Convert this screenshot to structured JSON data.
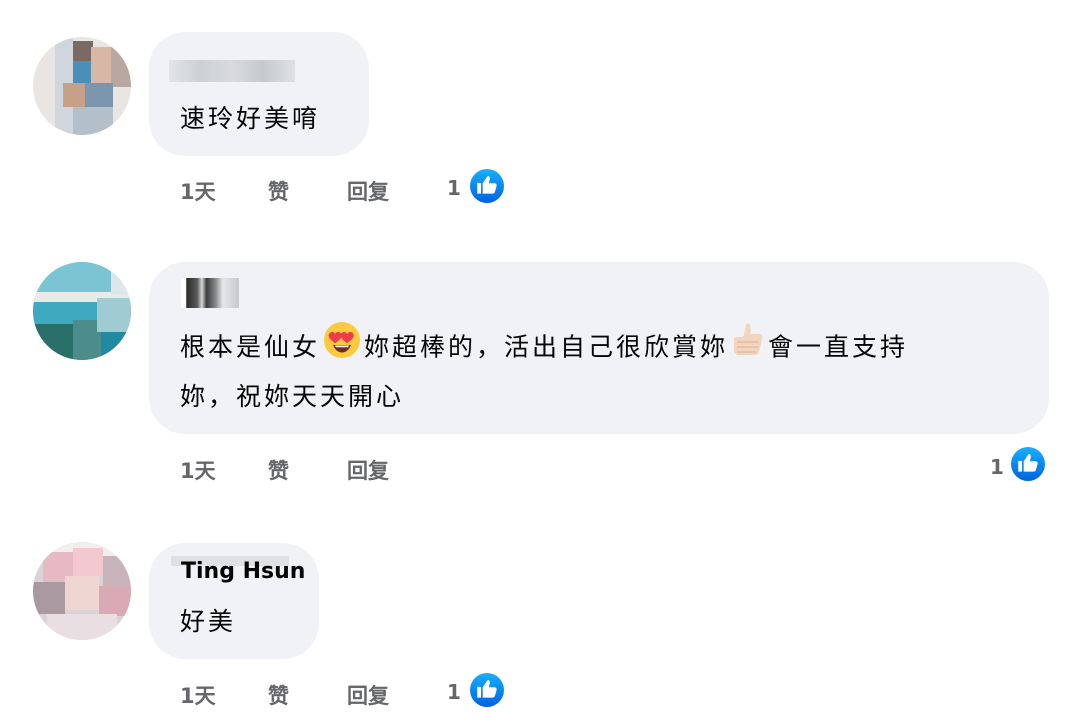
{
  "comments": [
    {
      "author": "",
      "text_lines": [
        "速玲好美唷"
      ],
      "time": "1天",
      "like_label": "赞",
      "reply_label": "回复",
      "reaction_count": "1",
      "reaction_icon": "like-icon"
    },
    {
      "author": "",
      "text_parts": {
        "p1": "根本是仙女",
        "emoji1": "heart-eyes-emoji",
        "p2": "妳超棒的，活出自己很欣賞妳",
        "emoji2": "thumbs-up-emoji",
        "p3": "會一直支持",
        "line2": "妳，祝妳天天開心"
      },
      "time": "1天",
      "like_label": "赞",
      "reply_label": "回复",
      "reaction_count": "1",
      "reaction_icon": "like-icon"
    },
    {
      "author": "Ting Hsun",
      "text_lines": [
        "好美"
      ],
      "time": "1天",
      "like_label": "赞",
      "reply_label": "回复",
      "reaction_count": "1",
      "reaction_icon": "like-icon"
    }
  ],
  "colors": {
    "bubble": "#f0f2f5",
    "meta_text": "#65676b",
    "like_blue": "#1877f2"
  }
}
